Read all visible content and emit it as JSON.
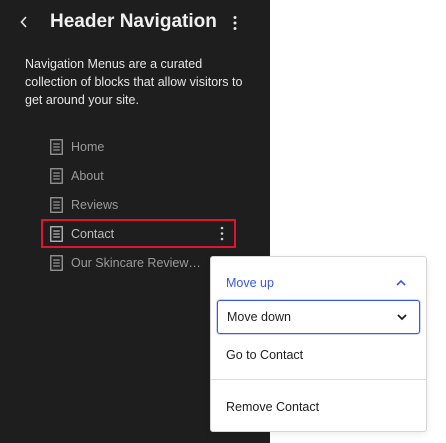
{
  "header": {
    "title": "Header Navigation"
  },
  "description": "Navigation Menus are a curated collection of blocks that allow visitors to get around your site.",
  "nav_items": [
    {
      "label": "Home"
    },
    {
      "label": "About"
    },
    {
      "label": "Reviews"
    },
    {
      "label": "Contact",
      "selected": true
    },
    {
      "label": "Our Skincare Review St..."
    }
  ],
  "context_menu": {
    "move_up": "Move up",
    "move_down": "Move down",
    "go_to": "Go to Contact",
    "remove": "Remove Contact"
  },
  "colors": {
    "panel_bg": "#1e1e1e",
    "accent": "#3858e9",
    "selection_outline": "#e0142d"
  }
}
